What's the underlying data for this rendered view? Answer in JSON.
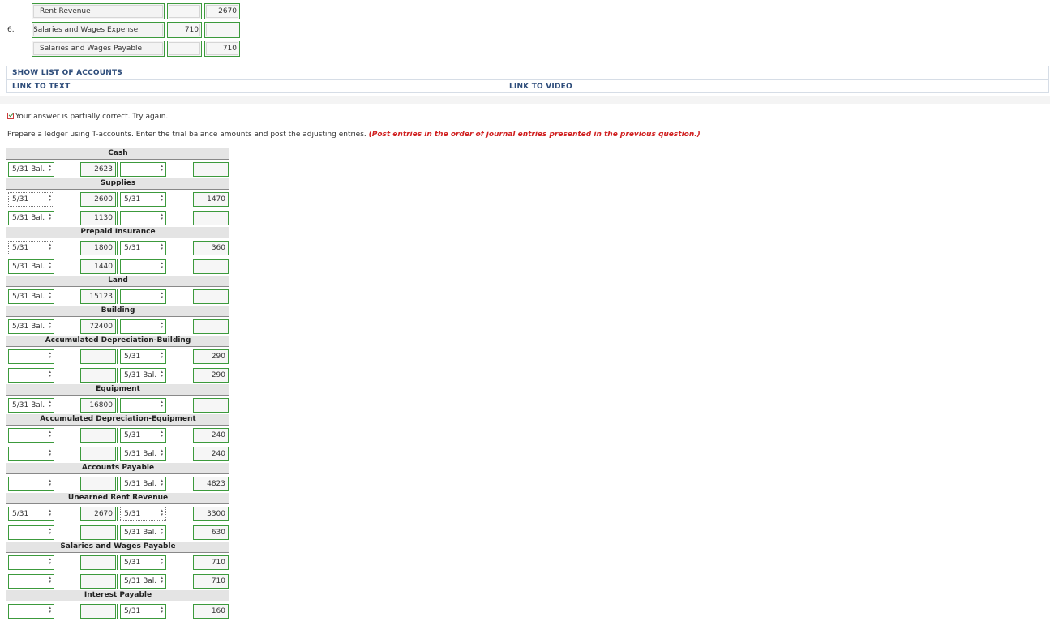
{
  "journal": {
    "rows": [
      {
        "num": "",
        "account": "Rent Revenue",
        "debit": "",
        "credit": "2670"
      },
      {
        "num": "6.",
        "account": "Salaries and Wages Expense",
        "debit": "710",
        "credit": ""
      },
      {
        "num": "",
        "account": "Salaries and Wages Payable",
        "debit": "",
        "credit": "710"
      }
    ]
  },
  "links": {
    "show_accounts": "SHOW LIST OF ACCOUNTS",
    "link_text": "LINK TO TEXT",
    "link_video": "LINK TO VIDEO"
  },
  "status": "Your answer is partially correct.  Try again.",
  "instructions": {
    "main": "Prepare a ledger using T-accounts. Enter the trial balance amounts and post the adjusting entries. ",
    "note": "(Post entries in the order of journal entries presented in the previous question.)"
  },
  "taccounts": [
    {
      "title": "Cash",
      "rows": [
        {
          "ld": "5/31 Bal.",
          "la": "2623",
          "rd": "",
          "ra": ""
        }
      ]
    },
    {
      "title": "Supplies",
      "rows": [
        {
          "ld": "5/31",
          "la": "2600",
          "rd": "5/31",
          "ra": "1470",
          "ldDotted": true
        },
        {
          "ld": "5/31 Bal.",
          "la": "1130",
          "rd": "",
          "ra": ""
        }
      ]
    },
    {
      "title": "Prepaid Insurance",
      "rows": [
        {
          "ld": "5/31",
          "la": "1800",
          "rd": "5/31",
          "ra": "360",
          "ldDotted": true
        },
        {
          "ld": "5/31 Bal.",
          "la": "1440",
          "rd": "",
          "ra": ""
        }
      ]
    },
    {
      "title": "Land",
      "rows": [
        {
          "ld": "5/31 Bal.",
          "la": "15123",
          "rd": "",
          "ra": ""
        }
      ]
    },
    {
      "title": "Building",
      "rows": [
        {
          "ld": "5/31 Bal.",
          "la": "72400",
          "rd": "",
          "ra": ""
        }
      ]
    },
    {
      "title": "Accumulated Depreciation-Building",
      "rows": [
        {
          "ld": "",
          "la": "",
          "rd": "5/31",
          "ra": "290"
        },
        {
          "ld": "",
          "la": "",
          "rd": "5/31 Bal.",
          "ra": "290"
        }
      ]
    },
    {
      "title": "Equipment",
      "rows": [
        {
          "ld": "5/31 Bal.",
          "la": "16800",
          "rd": "",
          "ra": ""
        }
      ]
    },
    {
      "title": "Accumulated Depreciation-Equipment",
      "rows": [
        {
          "ld": "",
          "la": "",
          "rd": "5/31",
          "ra": "240"
        },
        {
          "ld": "",
          "la": "",
          "rd": "5/31 Bal.",
          "ra": "240"
        }
      ]
    },
    {
      "title": "Accounts Payable",
      "rows": [
        {
          "ld": "",
          "la": "",
          "rd": "5/31 Bal.",
          "ra": "4823"
        }
      ]
    },
    {
      "title": "Unearned Rent Revenue",
      "rows": [
        {
          "ld": "5/31",
          "la": "2670",
          "rd": "5/31",
          "ra": "3300",
          "rdDotted": true
        },
        {
          "ld": "",
          "la": "",
          "rd": "5/31 Bal.",
          "ra": "630"
        }
      ]
    },
    {
      "title": "Salaries and Wages Payable",
      "rows": [
        {
          "ld": "",
          "la": "",
          "rd": "5/31",
          "ra": "710"
        },
        {
          "ld": "",
          "la": "",
          "rd": "5/31 Bal.",
          "ra": "710"
        }
      ]
    },
    {
      "title": "Interest Payable",
      "rows": [
        {
          "ld": "",
          "la": "",
          "rd": "5/31",
          "ra": "160"
        }
      ]
    }
  ]
}
